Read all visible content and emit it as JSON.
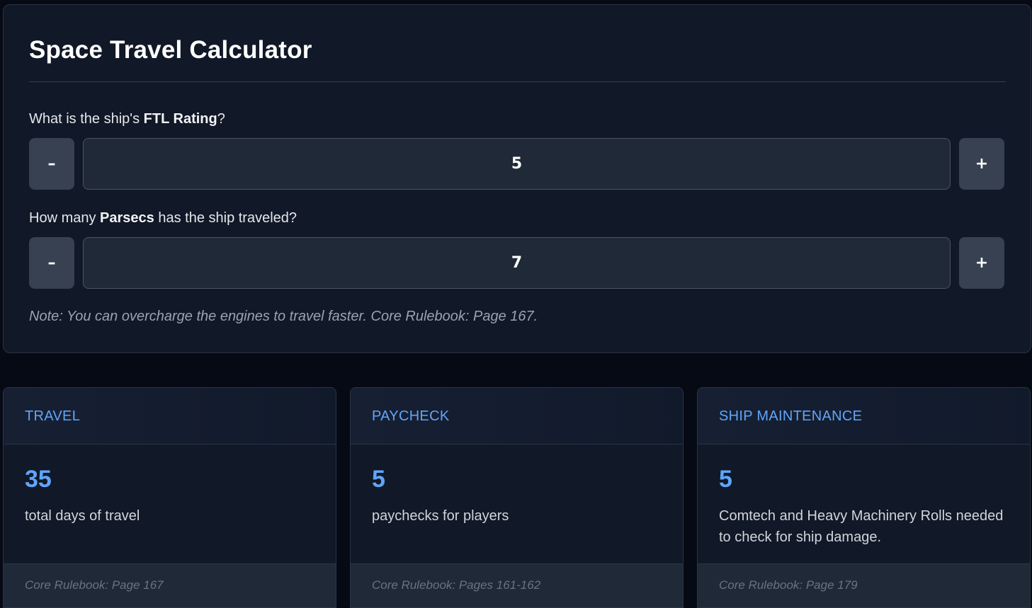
{
  "calculator": {
    "title": "Space Travel Calculator",
    "ftl_question": {
      "prefix": "What is the ship's ",
      "bold": "FTL Rating",
      "suffix": "?"
    },
    "ftl_value": "5",
    "parsec_question": {
      "prefix": "How many ",
      "bold": "Parsecs",
      "suffix": " has the ship traveled?"
    },
    "parsec_value": "7",
    "minus_label": "–",
    "plus_label": "+",
    "note": "Note: You can overcharge the engines to travel faster. Core Rulebook: Page 167."
  },
  "results": [
    {
      "heading": "TRAVEL",
      "value": "35",
      "description": "total days of travel",
      "reference": "Core Rulebook: Page 167"
    },
    {
      "heading": "PAYCHECK",
      "value": "5",
      "description": "paychecks for players",
      "reference": "Core Rulebook: Pages 161-162"
    },
    {
      "heading": "SHIP MAINTENANCE",
      "value": "5",
      "description": "Comtech and Heavy Machinery Rolls needed to check for ship damage.",
      "reference": "Core Rulebook: Page 179"
    }
  ],
  "colors": {
    "accent": "#60a5fa",
    "panel": "#111827",
    "background": "#050a15",
    "button": "#374151",
    "input": "#1f2937"
  }
}
